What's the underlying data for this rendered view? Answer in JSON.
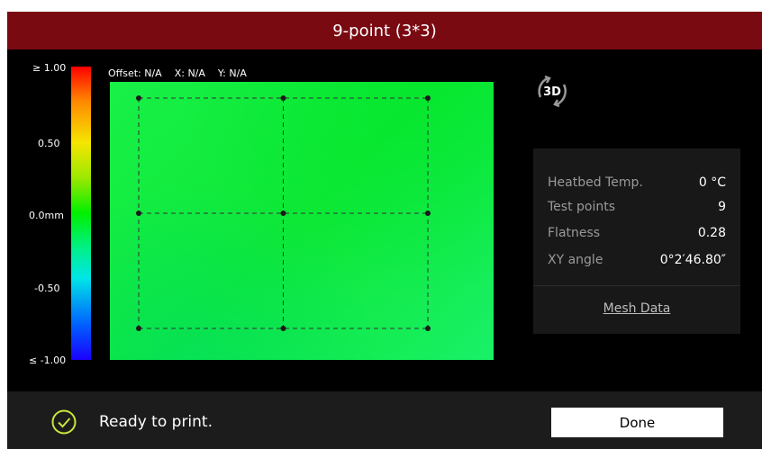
{
  "header": {
    "title": "9-point (3*3)"
  },
  "scale": {
    "max_label": "≥ 1.00",
    "upper_label": "0.50",
    "mid_label": "0.0mm",
    "lower_label": "-0.50",
    "min_label": "≤ -1.00"
  },
  "readout": {
    "offset": "Offset: N/A",
    "x": "X: N/A",
    "y": "Y: N/A"
  },
  "mesh": {
    "rows": 3,
    "cols": 3
  },
  "view_toggle": {
    "label": "3D",
    "icon": "rotate-3d-icon"
  },
  "info": {
    "heatbed_label": "Heatbed Temp.",
    "heatbed_value": "0 °C",
    "points_label": "Test points",
    "points_value": "9",
    "flatness_label": "Flatness",
    "flatness_value": "0.28",
    "angle_label": "XY angle",
    "angle_value": "0°2′46.80″",
    "mesh_data_label": "Mesh Data"
  },
  "status": {
    "text": "Ready to print.",
    "icon": "check-circle-icon",
    "color": "#c8e63c"
  },
  "footer": {
    "done_label": "Done"
  },
  "colors": {
    "title_bar": "#7a0a12",
    "background": "#000000",
    "surface": "#00f03c"
  }
}
